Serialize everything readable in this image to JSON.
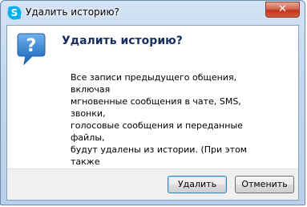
{
  "window": {
    "title": "Удалить историю?",
    "app_icon": "skype-icon",
    "close_glyph": "✕"
  },
  "dialog": {
    "icon": "question-icon",
    "heading": "Удалить историю?",
    "message": "Все записи предыдущего общения, включая\nмгновенные сообщения в чате, SMS, звонки,\nголосовые сообщения и переданные файлы,\nбудут удалены из истории. (При этом также\nзакроются все открытые чаты.)"
  },
  "buttons": {
    "delete_label": "Удалить",
    "cancel_label": "Отменить"
  },
  "colors": {
    "heading": "#1a3060",
    "icon_blue": "#2a7fd4",
    "close_red": "#c0351d"
  }
}
